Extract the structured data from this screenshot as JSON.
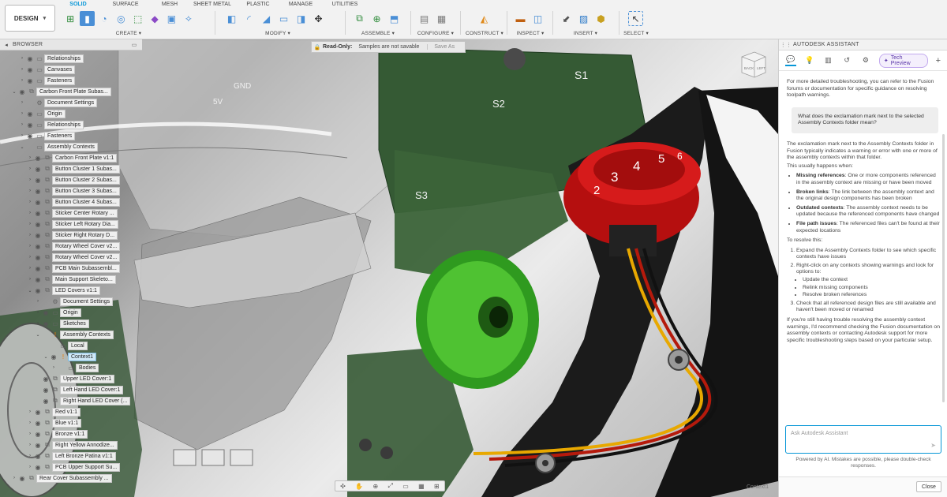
{
  "toolbar": {
    "workspace": "DESIGN",
    "tabs": [
      {
        "label": "SOLID",
        "active": true
      },
      {
        "label": "SURFACE",
        "active": false
      },
      {
        "label": "MESH",
        "active": false
      },
      {
        "label": "SHEET METAL",
        "active": false
      },
      {
        "label": "PLASTIC",
        "active": false
      },
      {
        "label": "MANAGE",
        "active": false
      },
      {
        "label": "UTILITIES",
        "active": false
      }
    ],
    "groups": {
      "create": "CREATE ▾",
      "modify": "MODIFY ▾",
      "assemble": "ASSEMBLE ▾",
      "configure": "CONFIGURE ▾",
      "construct": "CONSTRUCT ▾",
      "inspect": "INSPECT ▾",
      "insert": "INSERT ▾",
      "select": "SELECT ▾"
    }
  },
  "readonly": {
    "label": "Read-Only:",
    "message": "Samples are not savable",
    "save_as": "Save As"
  },
  "browser": {
    "title": "BROWSER",
    "items": [
      {
        "label": "Relationships",
        "indent": 2,
        "icon": "folder",
        "arrow": "›",
        "eye": true
      },
      {
        "label": "Canvases",
        "indent": 2,
        "icon": "folder",
        "arrow": "›",
        "eye": true
      },
      {
        "label": "Fasteners",
        "indent": 2,
        "icon": "folder",
        "arrow": "›",
        "eye": true
      },
      {
        "label": "Carbon Front Plate Subas...",
        "indent": 1,
        "icon": "component",
        "arrow": "⌄",
        "eye": true
      },
      {
        "label": "Document Settings",
        "indent": 2,
        "icon": "gear",
        "arrow": "›",
        "eye": false
      },
      {
        "label": "Origin",
        "indent": 2,
        "icon": "folder",
        "arrow": "›",
        "eye": true
      },
      {
        "label": "Relationships",
        "indent": 2,
        "icon": "folder",
        "arrow": "›",
        "eye": true
      },
      {
        "label": "Fasteners",
        "indent": 2,
        "icon": "folder",
        "arrow": "›",
        "eye": true
      },
      {
        "label": "Assembly Contexts",
        "indent": 2,
        "icon": "folder",
        "arrow": "⌄",
        "eye": false
      },
      {
        "label": "Carbon Front Plate v1:1",
        "indent": 3,
        "icon": "component",
        "arrow": "›",
        "eye": true
      },
      {
        "label": "Button Cluster 1 Subas...",
        "indent": 3,
        "icon": "component",
        "arrow": "›",
        "eye": true
      },
      {
        "label": "Button Cluster 2 Subas...",
        "indent": 3,
        "icon": "component",
        "arrow": "›",
        "eye": true
      },
      {
        "label": "Button Cluster 3 Subas...",
        "indent": 3,
        "icon": "component",
        "arrow": "›",
        "eye": true
      },
      {
        "label": "Button Cluster 4 Subas...",
        "indent": 3,
        "icon": "component",
        "arrow": "›",
        "eye": true
      },
      {
        "label": "Sticker Center Rotary ...",
        "indent": 3,
        "icon": "component",
        "arrow": "›",
        "eye": true
      },
      {
        "label": "Sticker Left Rotary Dia...",
        "indent": 3,
        "icon": "component",
        "arrow": "›",
        "eye": true
      },
      {
        "label": "Sticker Right Rotary D...",
        "indent": 3,
        "icon": "component",
        "arrow": "›",
        "eye": true
      },
      {
        "label": "Rotary Wheel Cover v2...",
        "indent": 3,
        "icon": "component",
        "arrow": "›",
        "eye": true
      },
      {
        "label": "Rotary Wheel Cover v2...",
        "indent": 3,
        "icon": "component",
        "arrow": "›",
        "eye": true
      },
      {
        "label": "PCB Main Subassembl...",
        "indent": 3,
        "icon": "component",
        "arrow": "›",
        "eye": true
      },
      {
        "label": "Main Support Skeleto...",
        "indent": 3,
        "icon": "component",
        "arrow": "›",
        "eye": true
      },
      {
        "label": "LED Covers v1:1",
        "indent": 3,
        "icon": "component",
        "arrow": "⌄",
        "eye": true
      },
      {
        "label": "Document Settings",
        "indent": 4,
        "icon": "gear",
        "arrow": "›",
        "eye": false
      },
      {
        "label": "Origin",
        "indent": 4,
        "icon": "folder",
        "arrow": "›",
        "eye": true
      },
      {
        "label": "Sketches",
        "indent": 4,
        "icon": "folder",
        "arrow": "›",
        "eye": true
      },
      {
        "label": "Assembly Contexts",
        "indent": 4,
        "icon": "warn",
        "arrow": "⌄",
        "eye": false
      },
      {
        "label": "Local",
        "indent": 5,
        "icon": "folder",
        "arrow": "",
        "eye": false
      },
      {
        "label": "Context1",
        "indent": 5,
        "icon": "warn",
        "arrow": "⌄",
        "eye": true,
        "selected": true
      },
      {
        "label": "Bodies",
        "indent": 6,
        "icon": "folder",
        "arrow": "›",
        "eye": false
      },
      {
        "label": "Upper LED Cover:1",
        "indent": 4,
        "icon": "component",
        "arrow": "",
        "eye": true
      },
      {
        "label": "Left Hand LED Cover:1",
        "indent": 4,
        "icon": "component",
        "arrow": "",
        "eye": true
      },
      {
        "label": "Right Hand LED Cover (...",
        "indent": 4,
        "icon": "component",
        "arrow": "",
        "eye": true
      },
      {
        "label": "Red v1:1",
        "indent": 3,
        "icon": "component",
        "arrow": "›",
        "eye": true
      },
      {
        "label": "Blue v1:1",
        "indent": 3,
        "icon": "component",
        "arrow": "›",
        "eye": true
      },
      {
        "label": "Bronze v1:1",
        "indent": 3,
        "icon": "component",
        "arrow": "›",
        "eye": true
      },
      {
        "label": "Right Yellow Annodize...",
        "indent": 3,
        "icon": "component",
        "arrow": "›",
        "eye": true
      },
      {
        "label": "Left Bronze Patina v1:1",
        "indent": 3,
        "icon": "component",
        "arrow": "›",
        "eye": true
      },
      {
        "label": "PCB Upper Support Su...",
        "indent": 3,
        "icon": "component",
        "arrow": "›",
        "eye": true
      },
      {
        "label": "Rear Cover Subassembly ...",
        "indent": 1,
        "icon": "component",
        "arrow": "›",
        "eye": true
      }
    ]
  },
  "viewport": {
    "pcb_labels": [
      "GND",
      "5V",
      "S1",
      "S2",
      "S3"
    ],
    "dial_numbers": [
      "2",
      "3",
      "4",
      "5",
      "6"
    ],
    "viewcube_faces": [
      "BACK",
      "LEFT"
    ],
    "context_label": "Context1"
  },
  "assistant": {
    "title": "AUTODESK ASSISTANT",
    "tech_preview": "Tech Preview",
    "intro": "For more detailed troubleshooting, you can refer to the Fusion forums or documentation for specific guidance on resolving toolpath warnings.",
    "user_question": "What does the exclamation mark next to the selected Assembly Contexts folder mean?",
    "answer_p1": "The exclamation mark next to the Assembly Contexts folder in Fusion typically indicates a warning or error with one or more of the assembly contexts within that folder.",
    "answer_p2": "This usually happens when:",
    "bullets": [
      {
        "title": "Missing references",
        "text": ": One or more components referenced in the assembly context are missing or have been moved"
      },
      {
        "title": "Broken links",
        "text": ": The link between the assembly context and the original design components has been broken"
      },
      {
        "title": "Outdated contexts",
        "text": ": The assembly context needs to be updated because the referenced components have changed"
      },
      {
        "title": "File path issues",
        "text": ": The referenced files can't be found at their expected locations"
      }
    ],
    "resolve_intro": "To resolve this:",
    "steps": [
      {
        "text": "Expand the Assembly Contexts folder to see which specific contexts have issues"
      },
      {
        "text": "Right-click on any contexts showing warnings and look for options to:",
        "sub": [
          "Update the context",
          "Relink missing components",
          "Resolve broken references"
        ]
      },
      {
        "text": "Check that all referenced design files are still available and haven't been moved or renamed"
      }
    ],
    "outro": "If you're still having trouble resolving the assembly context warnings, I'd recommend checking the Fusion documentation on assembly contexts or contacting Autodesk support for more specific troubleshooting steps based on your particular setup.",
    "input_placeholder": "Ask Autodesk Assistant",
    "disclaimer": "Powered by AI. Mistakes are possible, please double-check responses.",
    "close": "Close"
  }
}
